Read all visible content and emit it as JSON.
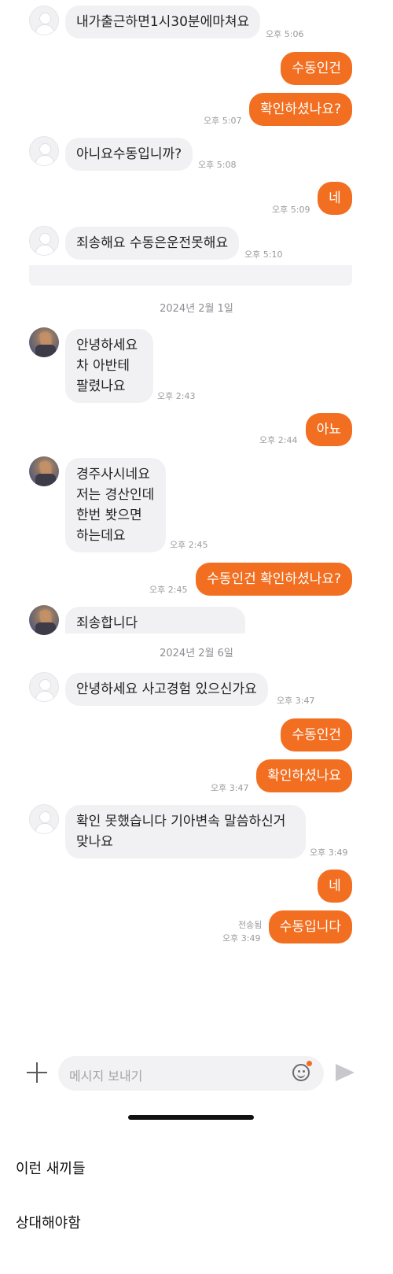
{
  "messages": {
    "m1": {
      "text": "내가출근하면1시30분에마쳐요",
      "time": "오후 5:06"
    },
    "m2": {
      "text": "수동인건"
    },
    "m3": {
      "text": "확인하셨나요?",
      "time": "오후 5:07"
    },
    "m4": {
      "text": "아니요수동입니까?",
      "time": "오후 5:08"
    },
    "m5": {
      "text": "네",
      "time": "오후 5:09"
    },
    "m6": {
      "text": "죄송해요 수동은운전못해요",
      "time": "오후 5:10"
    },
    "date1": "2024년 2월 1일",
    "m7": {
      "text": "안녕하세요\n차 아반테\n팔렸나요",
      "time": "오후 2:43"
    },
    "m8": {
      "text": "아뇨",
      "time": "오후 2:44"
    },
    "m9": {
      "text": "경주사시네요\n저는 경산인데\n한번 봣으면\n하는데요",
      "time": "오후 2:45"
    },
    "m10": {
      "text": "수동인건 확인하셨나요?",
      "time": "오후 2:45"
    },
    "m11": {
      "text": "죄송합니다"
    },
    "date2": "2024년 2월 6일",
    "m12": {
      "text": "안녕하세요  사고경험 있으신가요",
      "time": "오후 3:47"
    },
    "m13": {
      "text": "수동인건"
    },
    "m14": {
      "text": "확인하셨나요",
      "time": "오후 3:47"
    },
    "m15": {
      "text": "확인 못했습니다  기아변속 말씀하신거\n맞나요",
      "time": "오후 3:49"
    },
    "m16": {
      "text": "네"
    },
    "m17": {
      "text": "수동입니다",
      "status": "전송됨",
      "time": "오후 3:49"
    }
  },
  "input": {
    "placeholder": "메시지 보내기"
  },
  "icons": {
    "add": "plus-icon",
    "emoji": "emoji-icon",
    "send": "send-icon",
    "accent": "#f26f21"
  },
  "caption": {
    "line1": "이런 새끼들",
    "line2": "상대해야함"
  }
}
